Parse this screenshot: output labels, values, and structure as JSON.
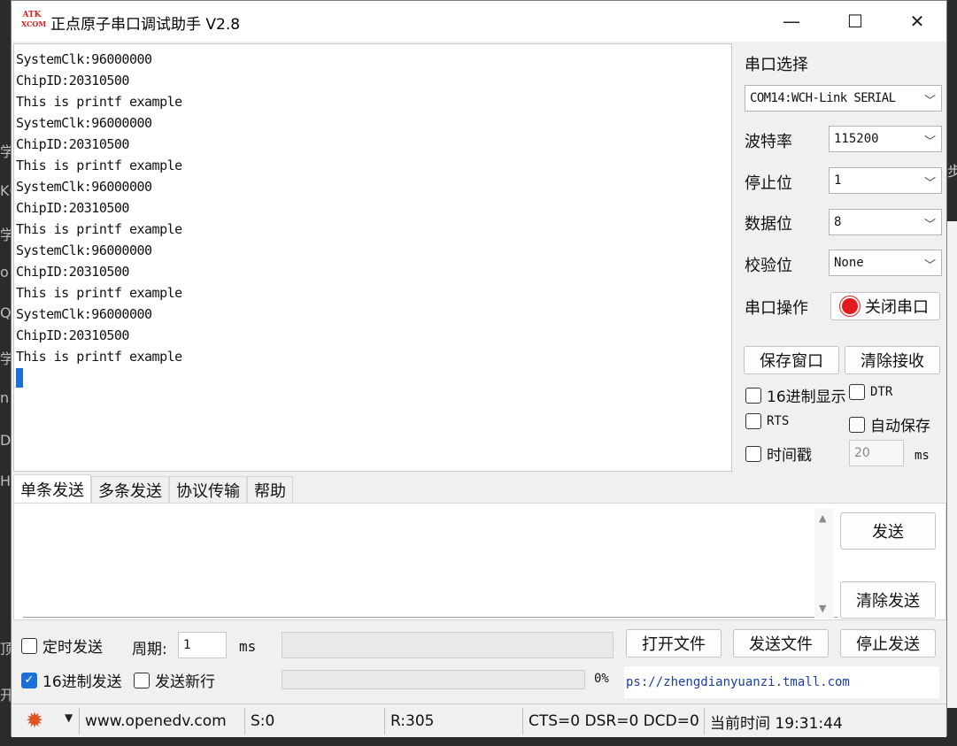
{
  "window": {
    "logo_top": "ATK",
    "logo_bottom": "XCOM",
    "title": "正点原子串口调试助手 V2.8",
    "minimize": "—",
    "maximize": "☐",
    "close": "✕"
  },
  "receive": {
    "lines": [
      "SystemClk:96000000",
      "ChipID:20310500",
      "This is printf example",
      "SystemClk:96000000",
      "ChipID:20310500",
      "This is printf example",
      "SystemClk:96000000",
      "ChipID:20310500",
      "This is printf example",
      "SystemClk:96000000",
      "ChipID:20310500",
      "This is printf example",
      "SystemClk:96000000",
      "ChipID:20310500",
      "This is printf example"
    ]
  },
  "settings": {
    "port_label": "串口选择",
    "port_value": "COM14:WCH-Link SERIAL",
    "baud_label": "波特率",
    "baud_value": "115200",
    "stop_label": "停止位",
    "stop_value": "1",
    "data_label": "数据位",
    "data_value": "8",
    "parity_label": "校验位",
    "parity_value": "None",
    "op_label": "串口操作",
    "op_button": "关闭串口",
    "save_window": "保存窗口",
    "clear_recv": "清除接收",
    "hex_display": "16进制显示",
    "dtr": "DTR",
    "rts": "RTS",
    "auto_save": "自动保存",
    "timestamp": "时间戳",
    "timestamp_value": "20",
    "ms": "ms"
  },
  "tabs": [
    "单条发送",
    "多条发送",
    "协议传输",
    "帮助"
  ],
  "send": {
    "send_button": "发送",
    "clear_send": "清除发送",
    "timed_send": "定时发送",
    "period_label": "周期:",
    "period_value": "1",
    "ms": "ms",
    "open_file": "打开文件",
    "send_file": "发送文件",
    "stop_send": "停止发送",
    "hex_send": "16进制发送",
    "send_newline": "发送新行",
    "progress": "0%",
    "url": "ps://zhengdianyuanzi.tmall.com"
  },
  "status": {
    "site": "www.openedv.com",
    "s": "S:0",
    "r": "R:305",
    "lines": "CTS=0 DSR=0 DCD=0",
    "time": "当前时间 19:31:44"
  },
  "colors": {
    "accent": "#1e6fd9",
    "logo": "#d21f1f",
    "gear": "#e0521f"
  }
}
